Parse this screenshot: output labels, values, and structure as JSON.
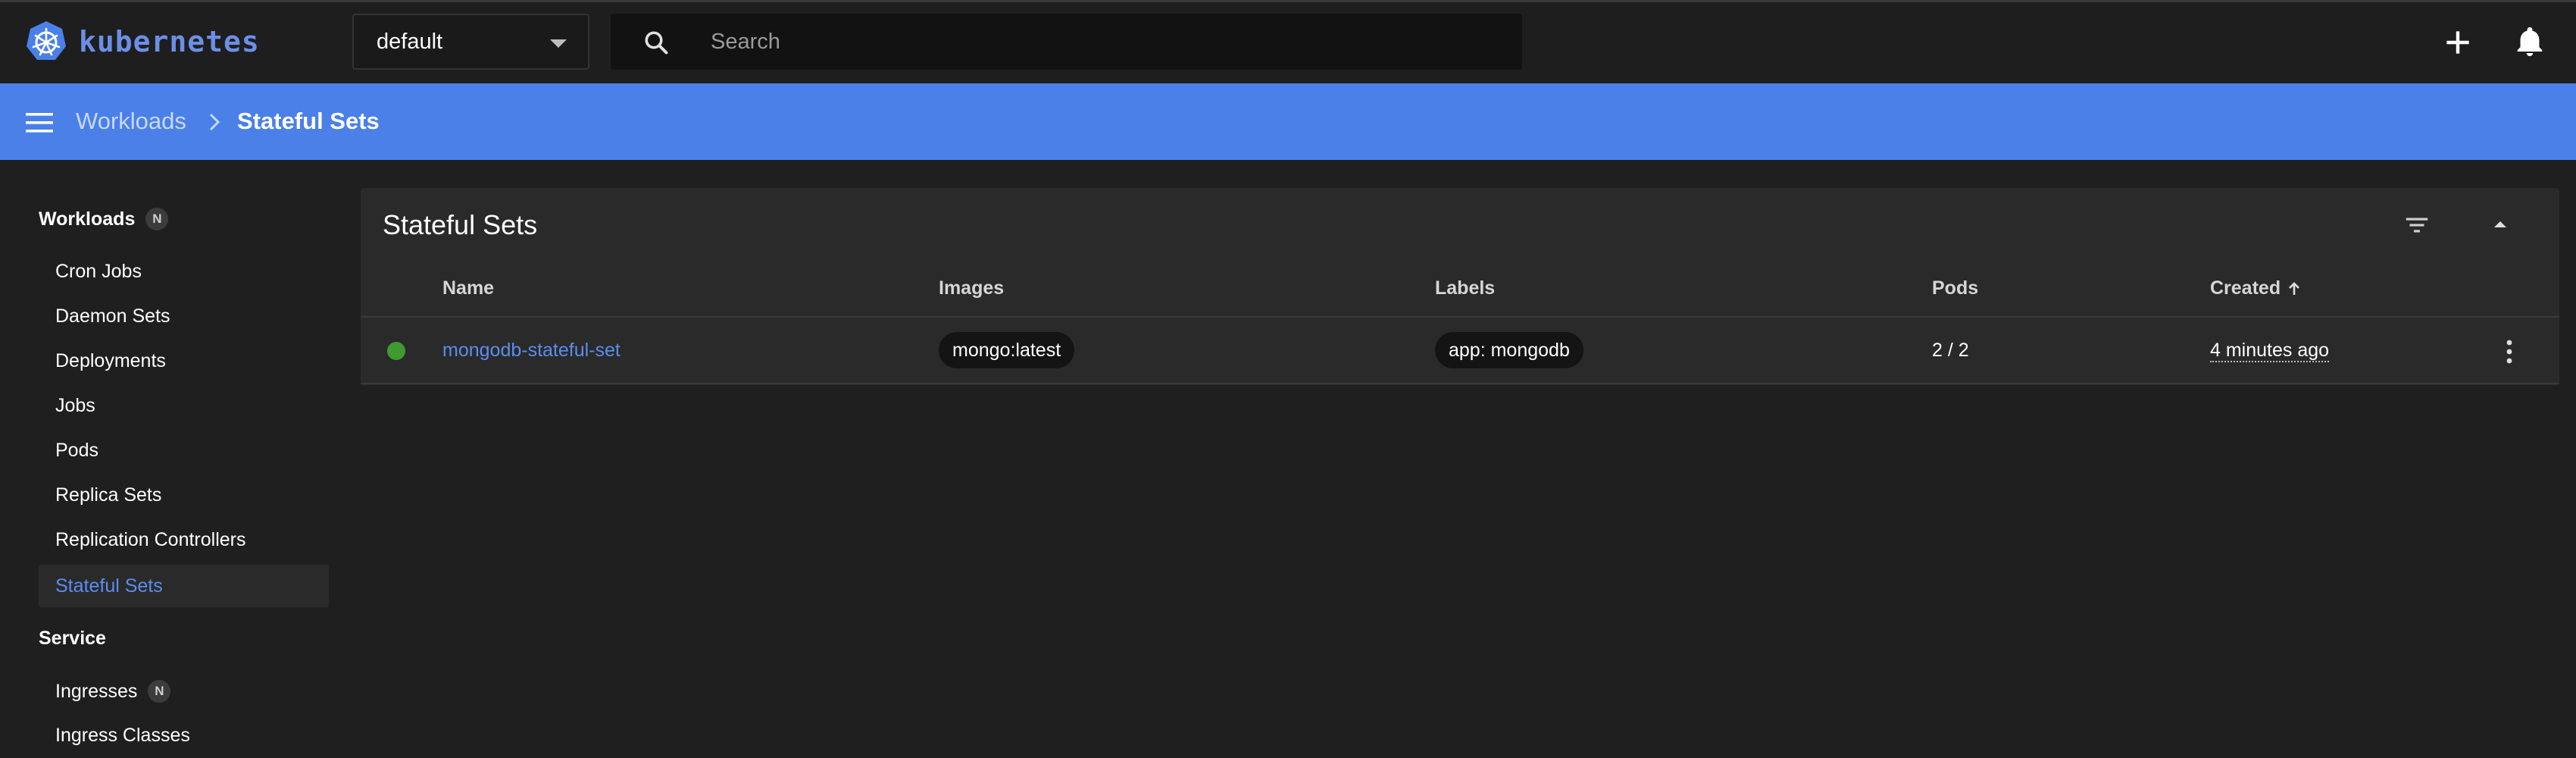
{
  "header": {
    "brand": "kubernetes",
    "namespace": "default",
    "search_placeholder": "Search"
  },
  "breadcrumb": {
    "parent": "Workloads",
    "current": "Stateful Sets"
  },
  "sidebar": {
    "workloads_label": "Workloads",
    "workloads_badge": "N",
    "items": [
      {
        "label": "Cron Jobs"
      },
      {
        "label": "Daemon Sets"
      },
      {
        "label": "Deployments"
      },
      {
        "label": "Jobs"
      },
      {
        "label": "Pods"
      },
      {
        "label": "Replica Sets"
      },
      {
        "label": "Replication Controllers"
      },
      {
        "label": "Stateful Sets"
      }
    ],
    "service_label": "Service",
    "service_items": [
      {
        "label": "Ingresses",
        "badge": "N"
      },
      {
        "label": "Ingress Classes"
      }
    ]
  },
  "table": {
    "title": "Stateful Sets",
    "columns": [
      "Name",
      "Images",
      "Labels",
      "Pods",
      "Created"
    ],
    "rows": [
      {
        "name": "mongodb-stateful-set",
        "image": "mongo:latest",
        "label": "app: mongodb",
        "pods": "2 / 2",
        "created": "4 minutes ago",
        "status_color": "#3f9a2f"
      }
    ]
  },
  "colors": {
    "accent": "#4a80e8",
    "link": "#5b8def",
    "status_ok": "#3f9a2f"
  }
}
